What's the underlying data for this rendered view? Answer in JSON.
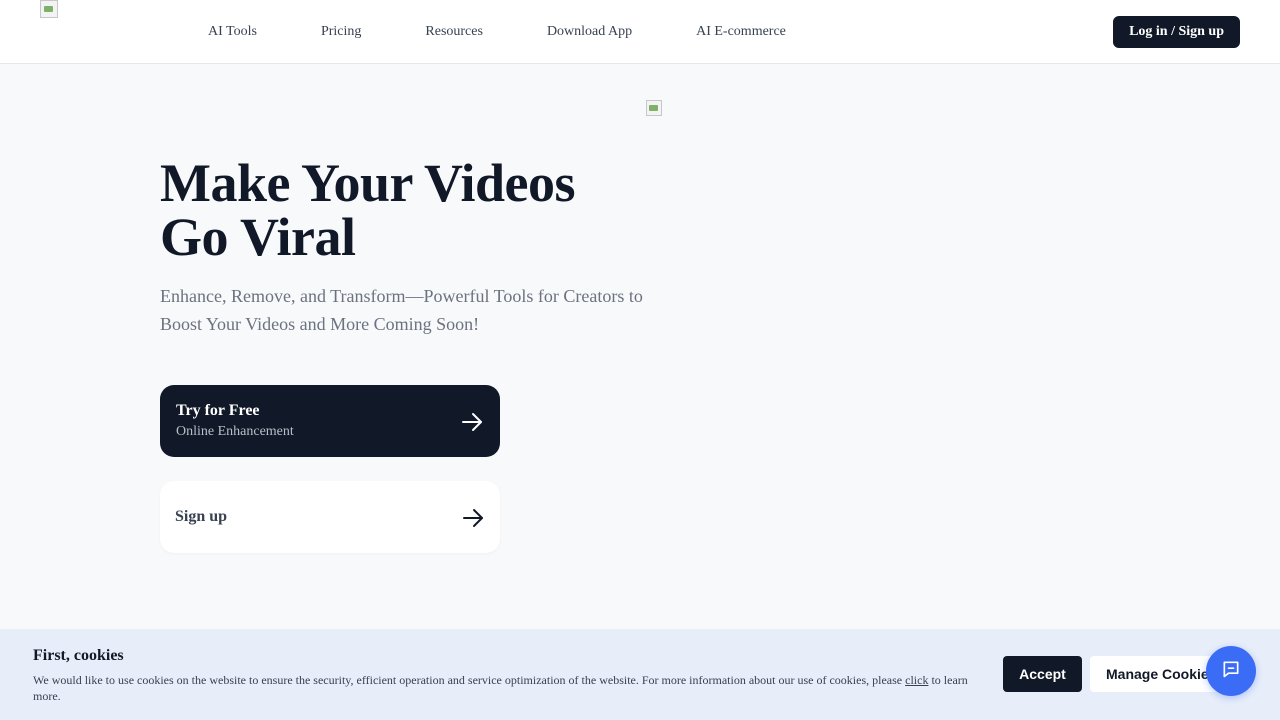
{
  "nav": {
    "items": [
      {
        "label": "AI Tools"
      },
      {
        "label": "Pricing"
      },
      {
        "label": "Resources"
      },
      {
        "label": "Download App"
      },
      {
        "label": "AI E-commerce"
      }
    ],
    "login_label": "Log in / Sign up"
  },
  "hero": {
    "title_line1": "Make Your Videos",
    "title_line2": "Go Viral",
    "subtitle": "Enhance, Remove, and Transform—Powerful Tools for Creators to Boost Your Videos and More Coming Soon!",
    "primary_cta": {
      "title": "Try for Free",
      "subtitle": "Online Enhancement",
      "icon": "arrow-right-icon"
    },
    "secondary_cta": {
      "title": "Sign up",
      "icon": "arrow-right-icon"
    }
  },
  "cookie_banner": {
    "title": "First, cookies",
    "text_before": "We would like to use cookies on the website to ensure the security, efficient operation and service optimization of the website. For more information about our use of cookies, please ",
    "link_text": "click",
    "text_after": " to learn more.",
    "accept_label": "Accept",
    "manage_label": "Manage Cookies"
  },
  "chat": {
    "icon": "chat-icon"
  },
  "colors": {
    "primary_dark": "#111827",
    "background": "#f8f9fb",
    "cookie_bg": "#e8eef9",
    "chat_blue": "#3b6cf6"
  }
}
